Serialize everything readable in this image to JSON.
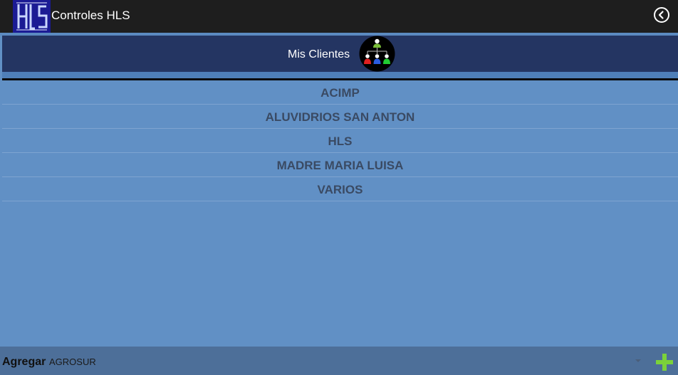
{
  "app": {
    "title": "Controles HLS",
    "logo_icon": "hls-logo"
  },
  "header": {
    "title": "Mis Clientes",
    "icon": "clients-hierarchy-icon"
  },
  "clients": [
    {
      "name": "ACIMP"
    },
    {
      "name": "ALUVIDRIOS SAN ANTON"
    },
    {
      "name": "HLS"
    },
    {
      "name": "MADRE MARIA LUISA"
    },
    {
      "name": "VARIOS"
    }
  ],
  "footer": {
    "add_label": "Agregar",
    "selected_client": "AGROSUR",
    "add_icon": "plus-icon"
  },
  "colors": {
    "action_bar": "#1e1e1e",
    "header_band": "#243562",
    "background": "#6190c5",
    "bottom_bar": "#4d6f99",
    "list_text": "#3a4a63",
    "add_button": "#7bd23a"
  }
}
